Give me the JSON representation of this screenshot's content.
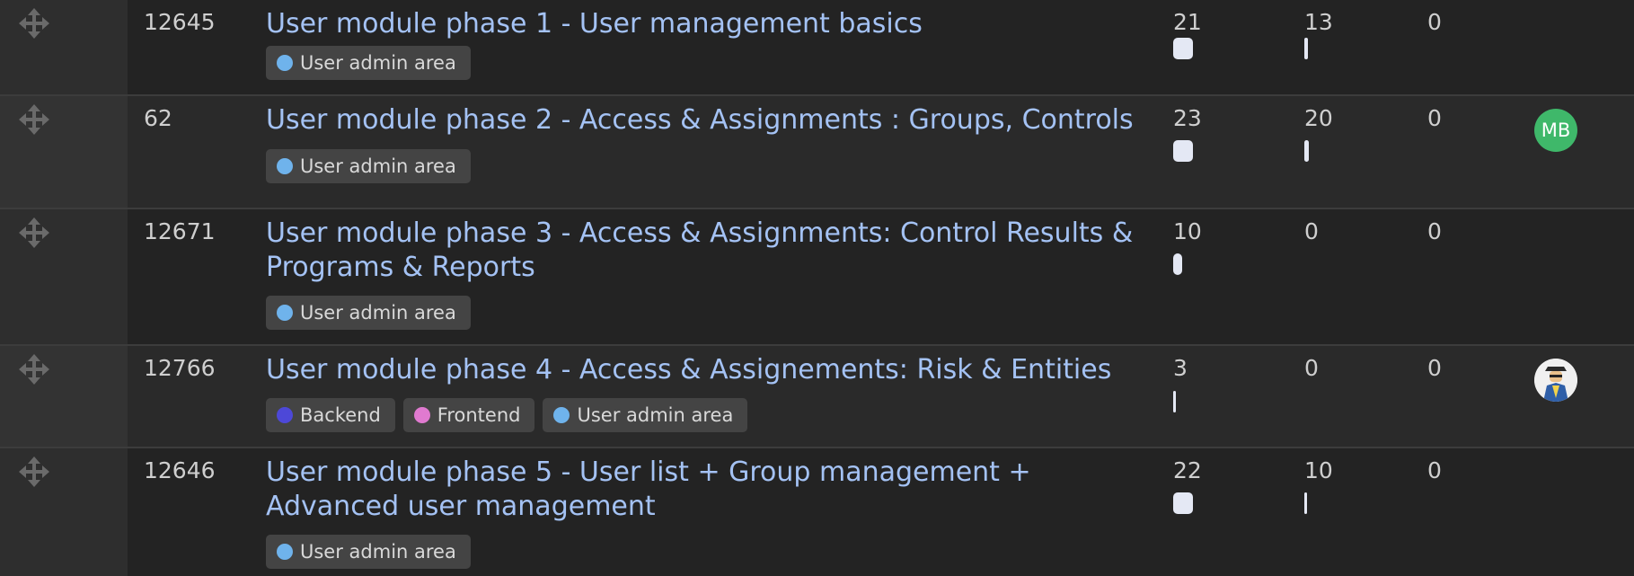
{
  "colors": {
    "user_admin_area": "#6fb3ec",
    "backend": "#4d48d8",
    "frontend": "#e07ad0",
    "avatar_mb": "#3fb86a",
    "title_link": "#a4c2f4"
  },
  "rows": [
    {
      "id": "12645",
      "title": "User module phase 1 - User management basics",
      "tags": [
        {
          "label": "User admin area",
          "color": "#6fb3ec"
        }
      ],
      "stat_a": "21",
      "stat_b": "13",
      "stat_c": "0"
    },
    {
      "id": "62",
      "title": "User module phase 2 - Access & Assignments : Groups, Controls",
      "tags": [
        {
          "label": "User admin area",
          "color": "#6fb3ec"
        }
      ],
      "stat_a": "23",
      "stat_b": "20",
      "stat_c": "0",
      "avatar": "MB"
    },
    {
      "id": "12671",
      "title": "User module phase 3 - Access & Assignments: Control Results & Programs & Reports",
      "tags": [
        {
          "label": "User admin area",
          "color": "#6fb3ec"
        }
      ],
      "stat_a": "10",
      "stat_b": "0",
      "stat_c": "0"
    },
    {
      "id": "12766",
      "title": "User module phase 4 - Access & Assignements: Risk & Entities",
      "tags": [
        {
          "label": "Backend",
          "color": "#4d48d8"
        },
        {
          "label": "Frontend",
          "color": "#e07ad0"
        },
        {
          "label": "User admin area",
          "color": "#6fb3ec"
        }
      ],
      "stat_a": "3",
      "stat_b": "0",
      "stat_c": "0",
      "avatar_icon": "illustrated-character-avatar"
    },
    {
      "id": "12646",
      "title": "User module phase 5 - User list + Group management + Advanced user management",
      "tags": [
        {
          "label": "User admin area",
          "color": "#6fb3ec"
        }
      ],
      "stat_a": "22",
      "stat_b": "10",
      "stat_c": "0"
    }
  ]
}
